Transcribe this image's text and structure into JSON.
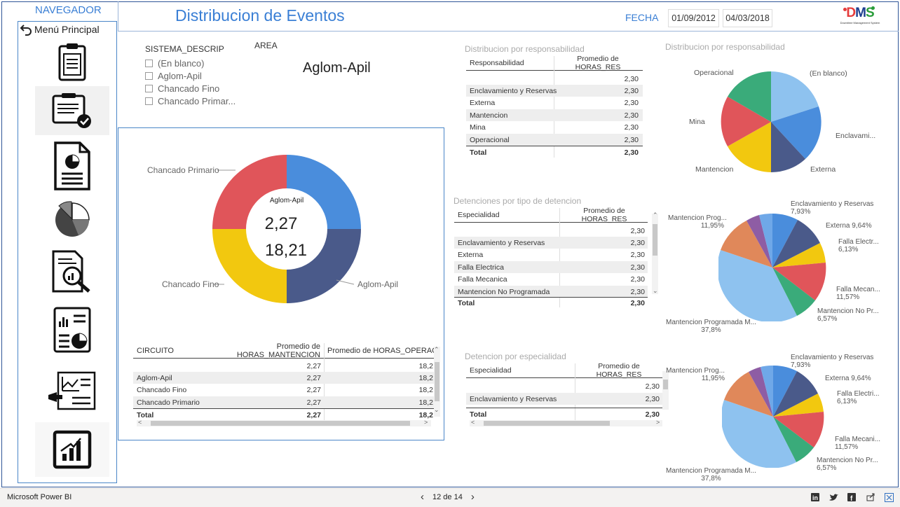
{
  "navigator": {
    "title": "NAVEGADOR",
    "main_menu": "Menú Principal",
    "icons": [
      "clipboard-icon",
      "clipboard-check-icon",
      "report-pie-document-icon",
      "pie-chart-3d-icon",
      "document-search-chart-icon",
      "report-chart-document-icon",
      "presentation-report-icon",
      "bar-chart-icon"
    ]
  },
  "header": {
    "title": "Distribucion de Eventos",
    "fecha_label": "FECHA",
    "date_start": "01/09/2012",
    "date_end": "04/03/2018",
    "logo_text": "DMS",
    "logo_subtitle": "Downtime Management System"
  },
  "slicer": {
    "title": "SISTEMA_DESCRIP",
    "items": [
      "(En blanco)",
      "Aglom-Apil",
      "Chancado Fino",
      "Chancado Primar..."
    ]
  },
  "area": {
    "label": "AREA",
    "value": "Aglom-Apil"
  },
  "donut": {
    "center_title": "Aglom-Apil",
    "center_value1": "2,27",
    "center_value2": "18,21",
    "labels": [
      "Chancado Primario",
      "Chancado Fino",
      "Aglom-Apil"
    ]
  },
  "circuito_table": {
    "headers": [
      "CIRCUITO",
      "Promedio de HORAS_MANTENCION",
      "Promedio de HORAS_OPERACION"
    ],
    "rows": [
      [
        "",
        "2,27",
        "18,2"
      ],
      [
        "Aglom-Apil",
        "2,27",
        "18,2"
      ],
      [
        "Chancado Fino",
        "2,27",
        "18,2"
      ],
      [
        "Chancado Primario",
        "2,27",
        "18,2"
      ]
    ],
    "total": [
      "Total",
      "2,27",
      "18,2"
    ]
  },
  "resp_table": {
    "title": "Distribucion por responsabilidad",
    "headers": [
      "Responsabilidad",
      "Promedio de HORAS_RES"
    ],
    "rows": [
      [
        "",
        "2,30"
      ],
      [
        "Enclavamiento y Reservas",
        "2,30"
      ],
      [
        "Externa",
        "2,30"
      ],
      [
        "Mantencion",
        "2,30"
      ],
      [
        "Mina",
        "2,30"
      ],
      [
        "Operacional",
        "2,30"
      ]
    ],
    "total": [
      "Total",
      "2,30"
    ]
  },
  "det_tipo_table": {
    "title": "Detenciones por tipo de detencion",
    "headers": [
      "Especialidad",
      "Promedio de HORAS_RES"
    ],
    "rows": [
      [
        "",
        "2,30"
      ],
      [
        "Enclavamiento y Reservas",
        "2,30"
      ],
      [
        "Externa",
        "2,30"
      ],
      [
        "Falla Electrica",
        "2,30"
      ],
      [
        "Falla Mecanica",
        "2,30"
      ],
      [
        "Mantencion No Programada",
        "2,30"
      ]
    ],
    "total": [
      "Total",
      "2,30"
    ]
  },
  "det_esp_table": {
    "title": "Detencion por especialidad",
    "headers": [
      "Especialidad",
      "Promedio de HORAS_RES"
    ],
    "rows": [
      [
        "",
        "2,30"
      ],
      [
        "Enclavamiento y Reservas",
        "2,30"
      ]
    ],
    "total": [
      "Total",
      "2,30"
    ]
  },
  "pie1": {
    "title": "Distribucion por responsabilidad",
    "labels": [
      "(En blanco)",
      "Enclavami...",
      "Externa",
      "Mantencion",
      "Mina",
      "Operacional"
    ]
  },
  "pie2": {
    "labels": [
      {
        "name": "Enclavamiento y Reservas",
        "pct": "7,93%"
      },
      {
        "name": "Externa",
        "pct": "9,64%"
      },
      {
        "name": "Falla Electr...",
        "pct": "6,13%"
      },
      {
        "name": "Falla Mecan...",
        "pct": "11,57%"
      },
      {
        "name": "Mantencion No Pr...",
        "pct": "6,57%"
      },
      {
        "name": "Mantencion Programada M...",
        "pct": "37,8%"
      },
      {
        "name": "Mantencion Prog...",
        "pct": "11,95%"
      }
    ]
  },
  "pie3": {
    "labels": [
      {
        "name": "Enclavamiento y Reservas",
        "pct": "7,93%"
      },
      {
        "name": "Externa",
        "pct": "9,64%"
      },
      {
        "name": "Falla Electri...",
        "pct": "6,13%"
      },
      {
        "name": "Falla Mecani...",
        "pct": "11,57%"
      },
      {
        "name": "Mantencion No Pr...",
        "pct": "6,57%"
      },
      {
        "name": "Mantencion Programada M...",
        "pct": "37,8%"
      },
      {
        "name": "Mantencion Prog...",
        "pct": "11,95%"
      }
    ]
  },
  "footer": {
    "brand": "Microsoft Power BI",
    "page": "12 de 14",
    "share_icons": [
      "linkedin-icon",
      "twitter-icon",
      "facebook-icon",
      "share-icon",
      "fullscreen-icon"
    ]
  },
  "colors": {
    "accent": "#3a7fd5",
    "blue": "#4a8ddc",
    "navy": "#4a5a8a",
    "yellow": "#f2c80f",
    "red": "#e0555a",
    "green": "#3aab7a",
    "light_blue": "#8ec2ef",
    "orange": "#e0885a",
    "purple": "#8e5da4"
  }
}
